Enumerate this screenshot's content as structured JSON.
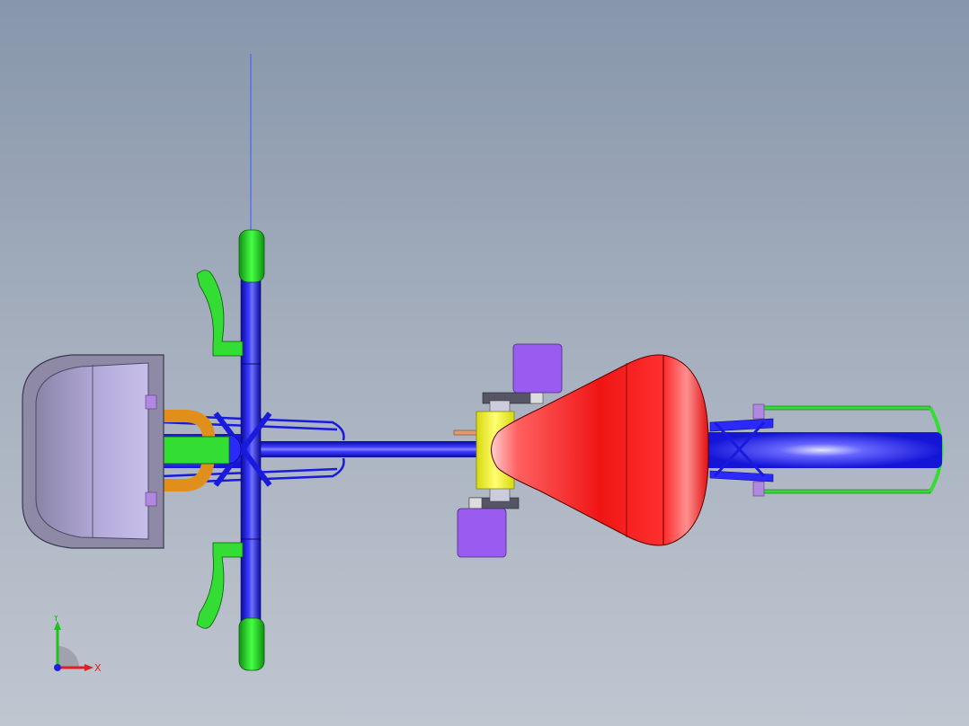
{
  "viewport": {
    "background_top": "#8796ab",
    "background_bottom": "#c0c6d0"
  },
  "model": {
    "frame_color": "#1a1adc",
    "grip_color": "#22dd22",
    "seat_color": "#f01515",
    "pedal_color": "#9a5cf0",
    "crank_color": "#f0f020",
    "basket_color": "#9a92b8",
    "lamp_color": "#e0901a",
    "fender_color": "#33dd33",
    "reflector_color": "#b088e0",
    "center_line_color": "#3a5cff"
  },
  "triad": {
    "y_label": "Y",
    "x_label": "X",
    "x_color": "#e02020",
    "y_color": "#20c020",
    "z_color": "#2020e0"
  }
}
